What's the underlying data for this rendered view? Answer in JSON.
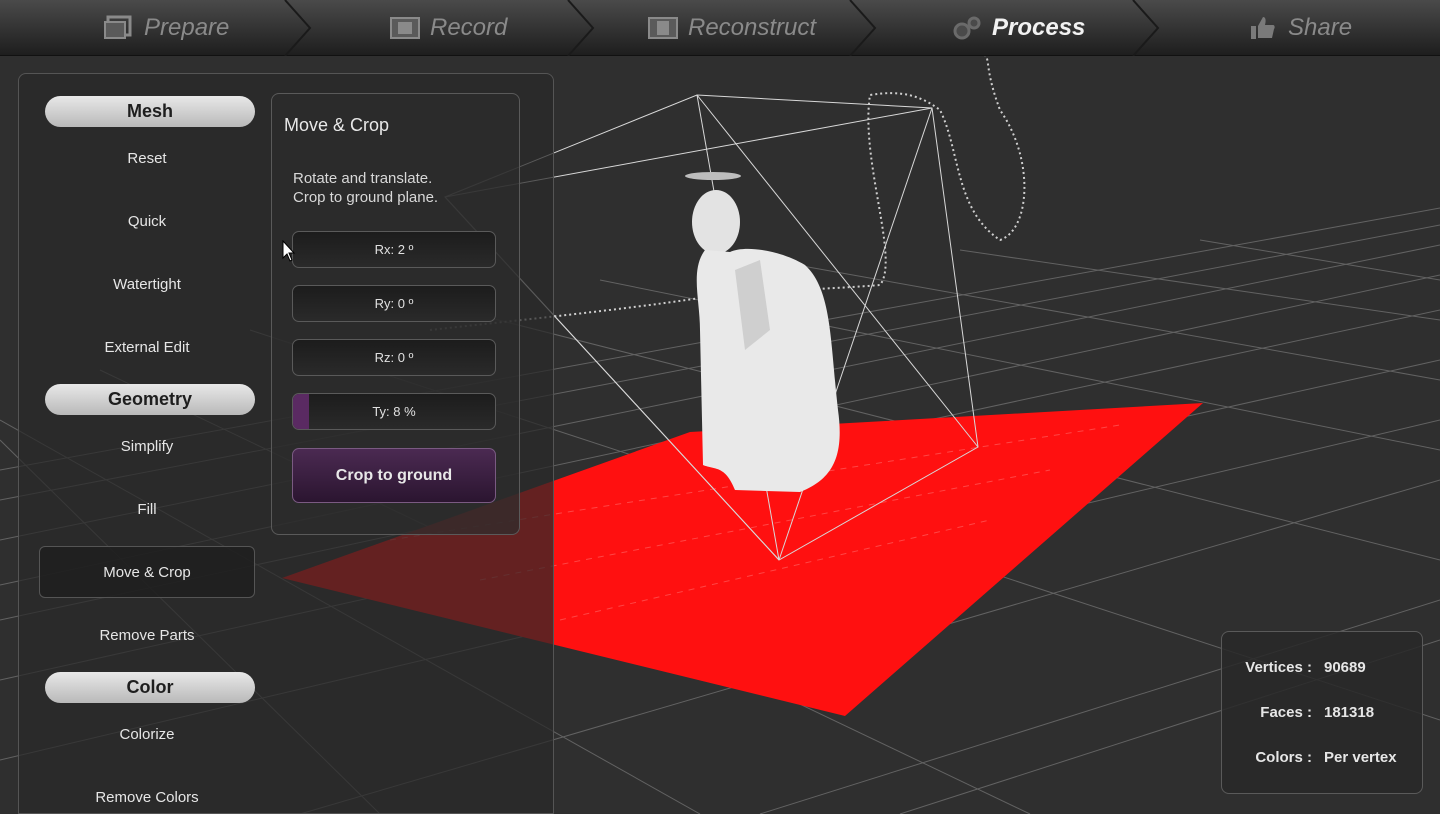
{
  "workflow": {
    "steps": [
      {
        "label": "Prepare",
        "icon": "photos-icon",
        "active": false
      },
      {
        "label": "Record",
        "icon": "film-icon",
        "active": false
      },
      {
        "label": "Reconstruct",
        "icon": "film-strip-icon",
        "active": false
      },
      {
        "label": "Process",
        "icon": "gears-icon",
        "active": true
      },
      {
        "label": "Share",
        "icon": "thumbs-up-icon",
        "active": false
      }
    ]
  },
  "sidebar": {
    "mesh": {
      "heading": "Mesh",
      "items": [
        "Reset",
        "Quick",
        "Watertight",
        "External Edit"
      ]
    },
    "geometry": {
      "heading": "Geometry",
      "items": [
        "Simplify",
        "Fill",
        "Move & Crop",
        "Remove Parts"
      ],
      "selected": "Move & Crop"
    },
    "color": {
      "heading": "Color",
      "items": [
        "Colorize",
        "Remove Colors"
      ]
    }
  },
  "move_crop": {
    "title": "Move & Crop",
    "description_line1": "Rotate and translate.",
    "description_line2": "Crop to ground plane.",
    "sliders": [
      {
        "label": "Rx: 2 º",
        "fill_percent": 0
      },
      {
        "label": "Ry: 0 º",
        "fill_percent": 0
      },
      {
        "label": "Rz: 0 º",
        "fill_percent": 0
      },
      {
        "label": "Ty: 8 %",
        "fill_percent": 8
      }
    ],
    "crop_button": "Crop to ground"
  },
  "stats": {
    "vertices_label": "Vertices :",
    "vertices_value": "90689",
    "faces_label": "Faces :",
    "faces_value": "181318",
    "colors_label": "Colors :",
    "colors_value": "Per vertex"
  },
  "colors": {
    "ground_plane": "#ff1010",
    "accent": "#5a2a62",
    "background": "#2e2e2e"
  }
}
